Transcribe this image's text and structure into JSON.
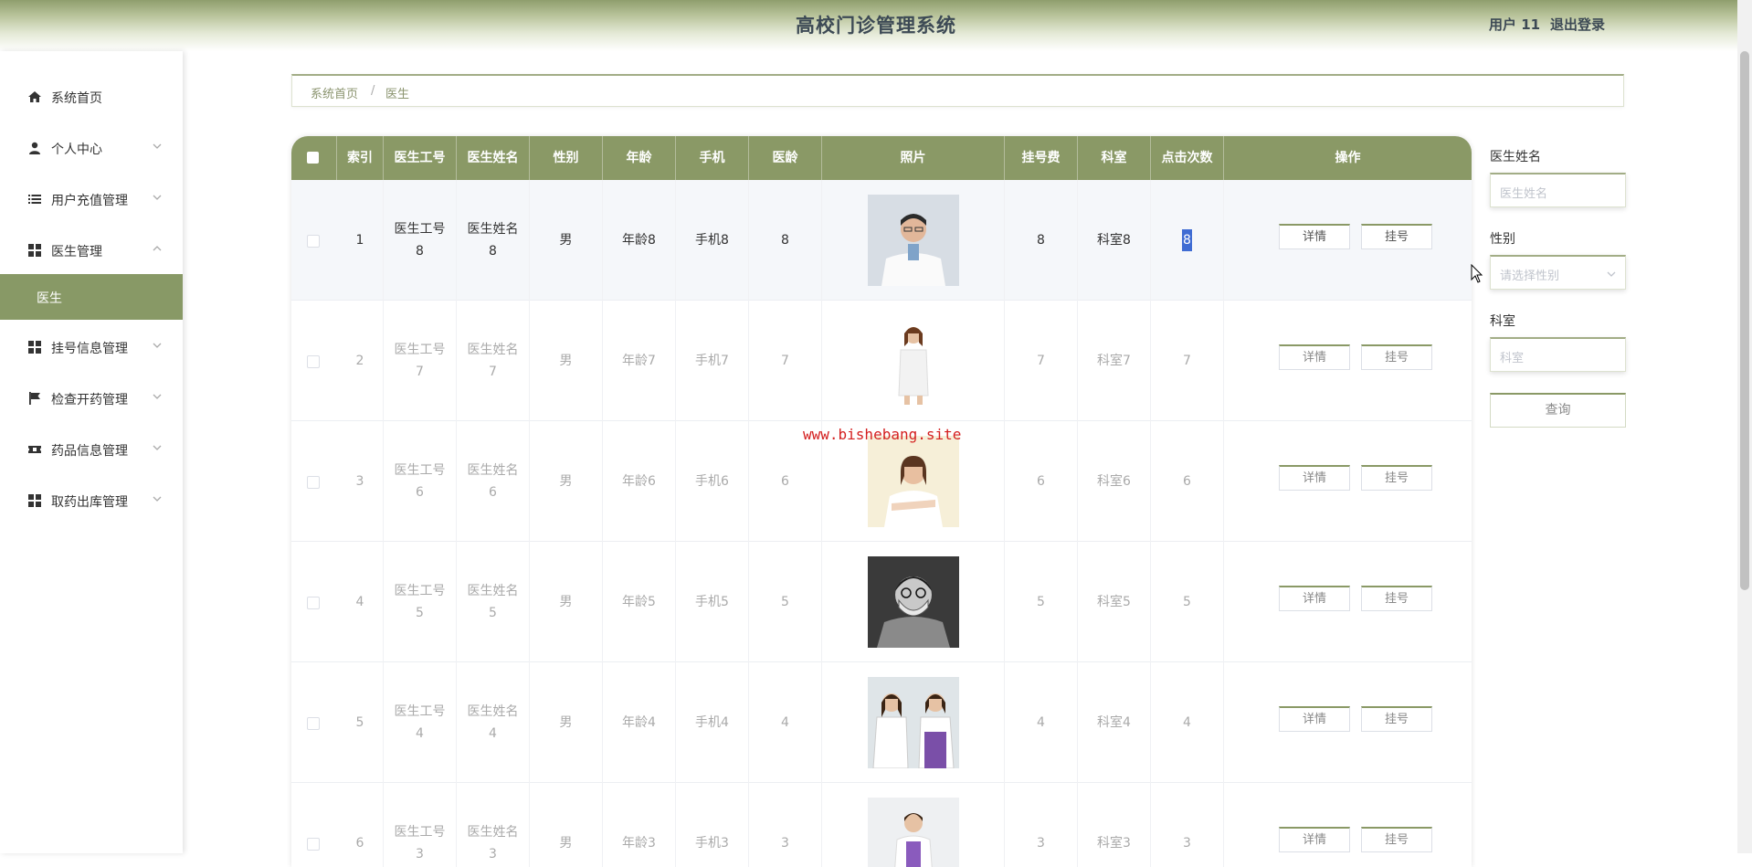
{
  "app": {
    "title": "高校门诊管理系统",
    "user": "用户 11",
    "logout": "退出登录"
  },
  "sidebar": {
    "items": [
      {
        "label": "系统首页",
        "icon": "home-icon"
      },
      {
        "label": "个人中心",
        "icon": "user-icon"
      },
      {
        "label": "用户充值管理",
        "icon": "list-icon"
      },
      {
        "label": "医生管理",
        "icon": "grid-icon"
      },
      {
        "label": "挂号信息管理",
        "icon": "grid-icon"
      },
      {
        "label": "检查开药管理",
        "icon": "flag-icon"
      },
      {
        "label": "药品信息管理",
        "icon": "ticket-icon"
      },
      {
        "label": "取药出库管理",
        "icon": "grid-icon"
      }
    ],
    "active_sub": "医生"
  },
  "breadcrumb": {
    "home": "系统首页",
    "separator": "/",
    "current": "医生"
  },
  "table": {
    "headers": [
      "索引",
      "医生工号",
      "医生姓名",
      "性别",
      "年龄",
      "手机",
      "医龄",
      "照片",
      "挂号费",
      "科室",
      "点击次数",
      "操作"
    ],
    "rows": [
      {
        "index": "1",
        "id_a": "医生工号",
        "id_b": "8",
        "name_a": "医生姓名",
        "name_b": "8",
        "gender": "男",
        "age": "年龄8",
        "phone": "手机8",
        "exp": "8",
        "fee": "8",
        "dept": "科室8",
        "clicks": "8"
      },
      {
        "index": "2",
        "id_a": "医生工号",
        "id_b": "7",
        "name_a": "医生姓名",
        "name_b": "7",
        "gender": "男",
        "age": "年龄7",
        "phone": "手机7",
        "exp": "7",
        "fee": "7",
        "dept": "科室7",
        "clicks": "7"
      },
      {
        "index": "3",
        "id_a": "医生工号",
        "id_b": "6",
        "name_a": "医生姓名",
        "name_b": "6",
        "gender": "男",
        "age": "年龄6",
        "phone": "手机6",
        "exp": "6",
        "fee": "6",
        "dept": "科室6",
        "clicks": "6"
      },
      {
        "index": "4",
        "id_a": "医生工号",
        "id_b": "5",
        "name_a": "医生姓名",
        "name_b": "5",
        "gender": "男",
        "age": "年龄5",
        "phone": "手机5",
        "exp": "5",
        "fee": "5",
        "dept": "科室5",
        "clicks": "5"
      },
      {
        "index": "5",
        "id_a": "医生工号",
        "id_b": "4",
        "name_a": "医生姓名",
        "name_b": "4",
        "gender": "男",
        "age": "年龄4",
        "phone": "手机4",
        "exp": "4",
        "fee": "4",
        "dept": "科室4",
        "clicks": "4"
      },
      {
        "index": "6",
        "id_a": "医生工号",
        "id_b": "3",
        "name_a": "医生姓名",
        "name_b": "3",
        "gender": "男",
        "age": "年龄3",
        "phone": "手机3",
        "exp": "3",
        "fee": "3",
        "dept": "科室3",
        "clicks": "3"
      }
    ],
    "btn_detail": "详情",
    "btn_register": "挂号"
  },
  "filters": {
    "name_label": "医生姓名",
    "name_placeholder": "医生姓名",
    "gender_label": "性别",
    "gender_placeholder": "请选择性别",
    "dept_label": "科室",
    "dept_placeholder": "科室",
    "query": "查询"
  },
  "watermark": "www.bishebang.site",
  "colors": {
    "accent": "#8a9966",
    "header_text": "#3d4a55",
    "highlight": "#3f6cd3"
  }
}
